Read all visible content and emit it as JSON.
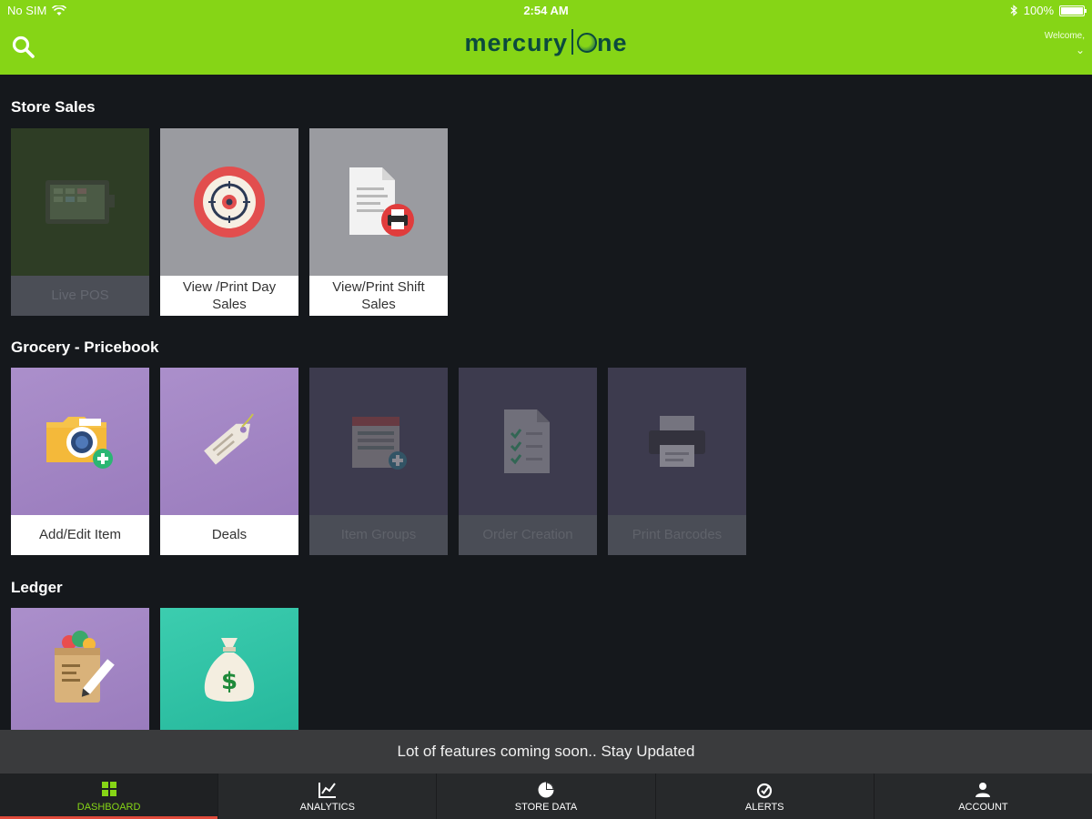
{
  "status_bar": {
    "carrier": "No SIM",
    "time": "2:54 AM",
    "battery": "100%"
  },
  "header": {
    "logo_left": "mercury",
    "logo_right": "ne",
    "welcome": "Welcome,"
  },
  "sections": {
    "store_sales": {
      "title": "Store Sales",
      "tiles": [
        {
          "label": "Live POS",
          "enabled": false
        },
        {
          "label": "View /Print Day Sales",
          "enabled": true
        },
        {
          "label": "View/Print Shift Sales",
          "enabled": true
        }
      ]
    },
    "grocery": {
      "title": "Grocery - Pricebook",
      "tiles": [
        {
          "label": "Add/Edit Item",
          "enabled": true
        },
        {
          "label": "Deals",
          "enabled": true
        },
        {
          "label": "Item Groups",
          "enabled": false
        },
        {
          "label": "Order Creation",
          "enabled": false
        },
        {
          "label": "Print Barcodes",
          "enabled": false
        }
      ]
    },
    "ledger": {
      "title": "Ledger"
    }
  },
  "toast": {
    "message": "Lot of features coming soon.. Stay Updated"
  },
  "bottom_nav": [
    {
      "label": "DASHBOARD",
      "icon": "dashboard-icon",
      "active": true
    },
    {
      "label": "ANALYTICS",
      "icon": "chart-icon",
      "active": false
    },
    {
      "label": "STORE DATA",
      "icon": "pie-chart-icon",
      "active": false
    },
    {
      "label": "ALERTS",
      "icon": "alerts-icon",
      "active": false
    },
    {
      "label": "ACCOUNT",
      "icon": "account-icon",
      "active": false
    }
  ],
  "colors": {
    "accent": "#86d516",
    "background": "#15181c",
    "active_underline": "#e04a3a"
  }
}
